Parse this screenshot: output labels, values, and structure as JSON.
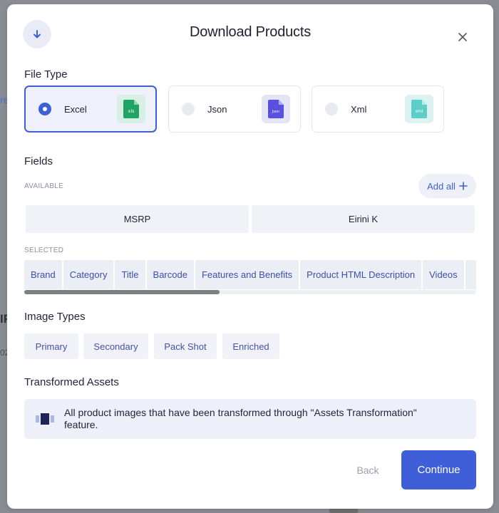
{
  "backdrop": {
    "fragments": [
      "re",
      "IF",
      "02"
    ]
  },
  "modal": {
    "title": "Download Products",
    "file_type": {
      "title": "File Type",
      "options": [
        {
          "label": "Excel",
          "icon_text": "xls",
          "selected": true,
          "icon_bg": "#d8efe3",
          "icon_fg": "#21a366"
        },
        {
          "label": "Json",
          "icon_text": "Json",
          "selected": false,
          "icon_bg": "#e3e5f7",
          "icon_fg": "#5a4fe0"
        },
        {
          "label": "Xml",
          "icon_text": "xml",
          "selected": false,
          "icon_bg": "#dcf2f1",
          "icon_fg": "#5ccdc8"
        }
      ]
    },
    "fields": {
      "title": "Fields",
      "available_label": "AVAILABLE",
      "add_all_label": "Add all",
      "available": [
        "MSRP",
        "Eirini K"
      ],
      "selected_label": "SELECTED",
      "selected": [
        "Brand",
        "Category",
        "Title",
        "Barcode",
        "Features and Benefits",
        "Product HTML Description",
        "Videos",
        ""
      ]
    },
    "image_types": {
      "title": "Image Types",
      "items": [
        "Primary",
        "Secondary",
        "Pack Shot",
        "Enriched"
      ]
    },
    "transformed_assets": {
      "title": "Transformed Assets",
      "info": "All product images that have been transformed through \"Assets Transformation\" feature."
    },
    "actions": {
      "back": "Back",
      "continue": "Continue"
    }
  },
  "colors": {
    "accent": "#3e5fd8"
  }
}
